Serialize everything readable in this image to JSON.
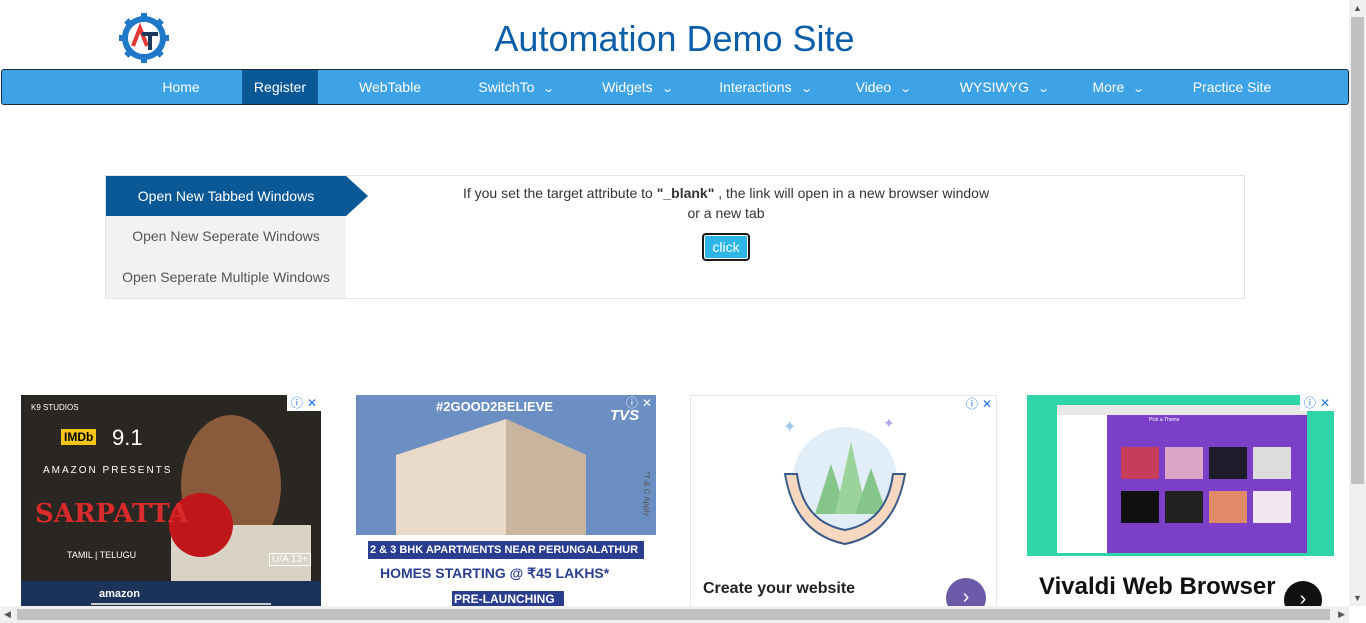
{
  "header": {
    "title": "Automation Demo Site",
    "logo_letters": "AT"
  },
  "nav": {
    "items": [
      {
        "label": "Home",
        "dropdown": false
      },
      {
        "label": "Register",
        "dropdown": false,
        "active": true
      },
      {
        "label": "WebTable",
        "dropdown": false
      },
      {
        "label": "SwitchTo",
        "dropdown": true
      },
      {
        "label": "Widgets",
        "dropdown": true
      },
      {
        "label": "Interactions",
        "dropdown": true
      },
      {
        "label": "Video",
        "dropdown": true
      },
      {
        "label": "WYSIWYG",
        "dropdown": true
      },
      {
        "label": "More",
        "dropdown": true
      },
      {
        "label": "Practice Site",
        "dropdown": false
      }
    ]
  },
  "windows": {
    "tabs": [
      {
        "label": "Open New Tabbed Windows",
        "active": true
      },
      {
        "label": "Open New Seperate Windows"
      },
      {
        "label": "Open Seperate Multiple Windows"
      }
    ],
    "text_before": "If you set the target attribute to ",
    "attr_value": "\"_blank\"",
    "text_after": " , the link will open in a new browser window or a new tab",
    "button_label": "click"
  },
  "ads": {
    "ad1": {
      "studio": "K9 STUDIOS",
      "imdb": "IMDb",
      "rating": "9.1",
      "presents": "AMAZON PRESENTS",
      "movie": "SARPATTA",
      "languages": "TAMIL | TELUGU",
      "certificate": "U/A 13+",
      "brand": "amazon"
    },
    "ad2": {
      "hashtag": "#2GOOD2BELIEVE",
      "brand": "TVS",
      "line1": "2 & 3 BHK APARTMENTS NEAR PERUNGALATHUR",
      "line2": "HOMES STARTING @ ₹45 LAKHS*",
      "line3": "PRE-LAUNCHING",
      "tc": "*T & C Apply"
    },
    "ad3": {
      "headline": "Create your website"
    },
    "ad4": {
      "headline": "Vivaldi Web Browser",
      "window_title": "Pick a Theme"
    },
    "icons": [
      "info-icon",
      "close-icon"
    ]
  },
  "colors": {
    "nav": "#3da3e6",
    "nav_active": "#0b5896",
    "title": "#0b5ea8",
    "button": "#2db5e5"
  }
}
